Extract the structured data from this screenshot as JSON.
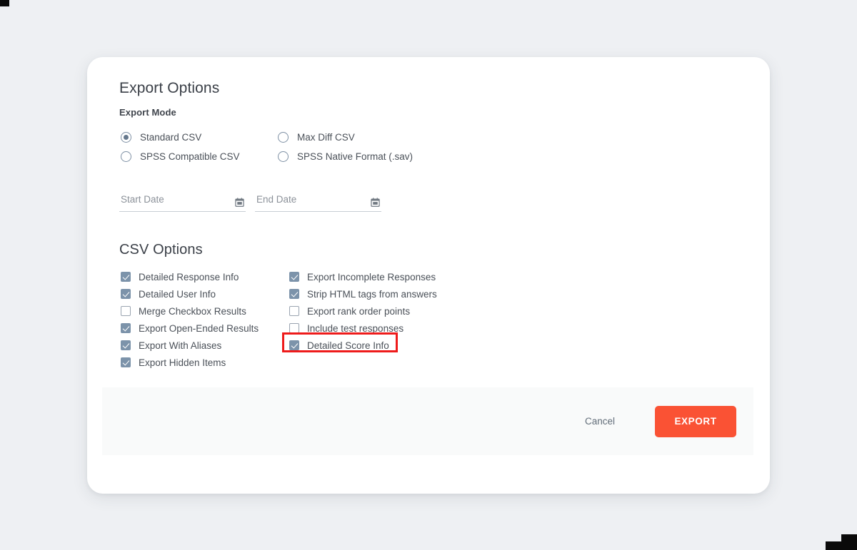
{
  "dialog": {
    "title": "Export Options",
    "export_mode_label": "Export Mode",
    "csv_options_title": "CSV Options"
  },
  "export_mode": {
    "left_options": [
      {
        "label": "Standard CSV",
        "selected": true
      },
      {
        "label": "SPSS Compatible CSV",
        "selected": false
      }
    ],
    "right_options": [
      {
        "label": "Max Diff CSV",
        "selected": false
      },
      {
        "label": "SPSS Native Format (.sav)",
        "selected": false
      }
    ]
  },
  "date_range": {
    "start": {
      "placeholder": "Start Date",
      "value": "",
      "icon": "calendar-icon"
    },
    "end": {
      "placeholder": "End Date",
      "value": "",
      "icon": "calendar-icon"
    }
  },
  "csv_options": {
    "left_column": [
      {
        "label": "Detailed Response Info",
        "checked": true
      },
      {
        "label": "Detailed User Info",
        "checked": true
      },
      {
        "label": "Merge Checkbox Results",
        "checked": false
      },
      {
        "label": "Export Open-Ended Results",
        "checked": true
      },
      {
        "label": "Export With Aliases",
        "checked": true
      },
      {
        "label": "Export Hidden Items",
        "checked": true
      }
    ],
    "right_column": [
      {
        "label": "Export Incomplete Responses",
        "checked": true
      },
      {
        "label": "Strip HTML tags from answers",
        "checked": true
      },
      {
        "label": "Export rank order points",
        "checked": false
      },
      {
        "label": "Include test responses",
        "checked": false
      },
      {
        "label": "Detailed Score Info",
        "checked": true,
        "highlighted": true
      }
    ]
  },
  "footer": {
    "cancel_label": "Cancel",
    "export_label": "EXPORT"
  },
  "colors": {
    "accent": "#fa5234",
    "highlight": "#ee1b1b",
    "control": "#7c93aa",
    "page_background": "#eef0f3",
    "card_background": "#ffffff",
    "footer_background": "#f9fafa"
  }
}
